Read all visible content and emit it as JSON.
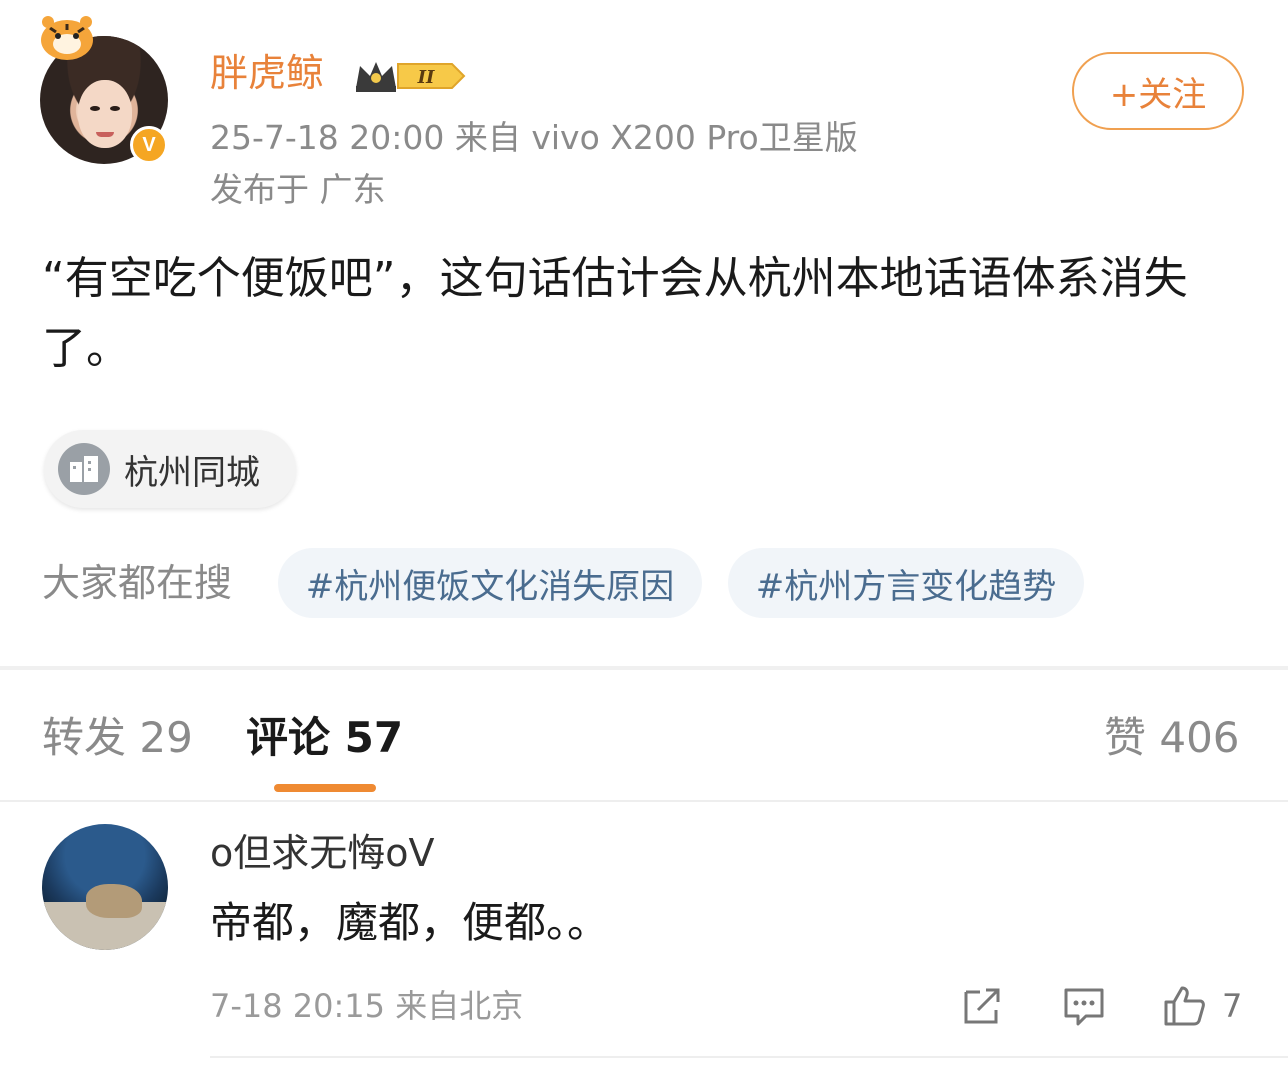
{
  "post": {
    "author": {
      "name": "胖虎鲸",
      "level_badge": "II",
      "verified_mark": "V"
    },
    "meta": {
      "time_source": "25-7-18 20:00  来自 vivo X200 Pro卫星版",
      "location": "发布于 广东"
    },
    "follow_label": "+关注",
    "text": "“有空吃个便饭吧”，这句话估计会从杭州本地话语体系消失了。",
    "city_chip": {
      "label": "杭州同城",
      "icon": "building-icon"
    },
    "search": {
      "label": "大家都在搜",
      "hashtags": [
        "#杭州便饭文化消失原因",
        "#杭州方言变化趋势"
      ]
    }
  },
  "tabs": {
    "repost": "转发 29",
    "comments": "评论 57",
    "likes": "赞 406"
  },
  "comment": {
    "user": "o但求无悔oV",
    "text": "帝都，魔都，便都。。",
    "meta": "7-18 20:15 来自北京",
    "like_count": "7",
    "actions": [
      "share-icon",
      "reply-icon",
      "thumbs-up-icon"
    ]
  },
  "colors": {
    "accent_orange": "#e8823a",
    "hashtag_text": "#4a6c8f",
    "muted_text": "#8a8a8a",
    "tab_indicator": "#ef8a32"
  }
}
